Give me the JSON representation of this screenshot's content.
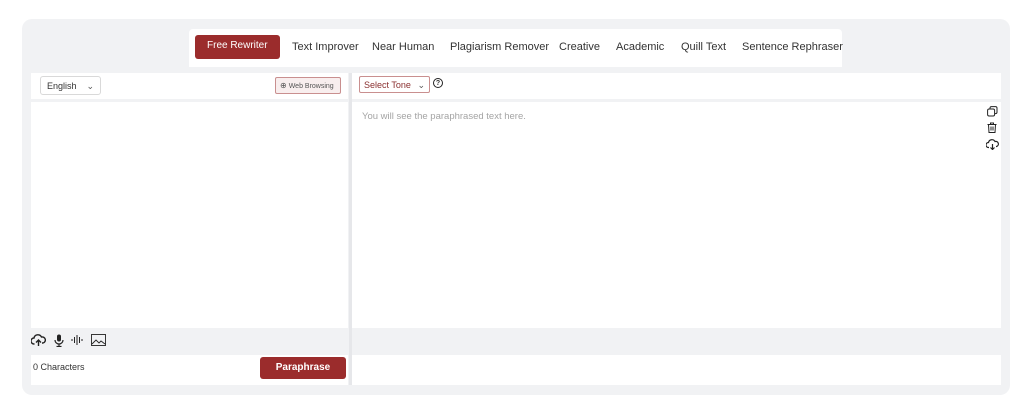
{
  "tabs": [
    {
      "label": "Free Rewriter",
      "active": true
    },
    {
      "label": "Text Improver"
    },
    {
      "label": "Near Human"
    },
    {
      "label": "Plagiarism Remover"
    },
    {
      "label": "Creative"
    },
    {
      "label": "Academic"
    },
    {
      "label": "Quill Text"
    },
    {
      "label": "Sentence Rephraser"
    }
  ],
  "left": {
    "language": "English",
    "web_browsing_label": "Web Browsing",
    "char_count": "0 Characters",
    "paraphrase_label": "Paraphrase",
    "tools": [
      "upload-icon",
      "microphone-icon",
      "audio-wave-icon",
      "image-icon"
    ]
  },
  "right": {
    "tone_label": "Select Tone",
    "placeholder": "You will see the paraphrased text here.",
    "icons": [
      "copy-icon",
      "trash-icon",
      "download-cloud-icon"
    ]
  },
  "colors": {
    "accent": "#9b2c2c",
    "frame_bg": "#f1f2f4",
    "panel_bg": "#ffffff"
  }
}
